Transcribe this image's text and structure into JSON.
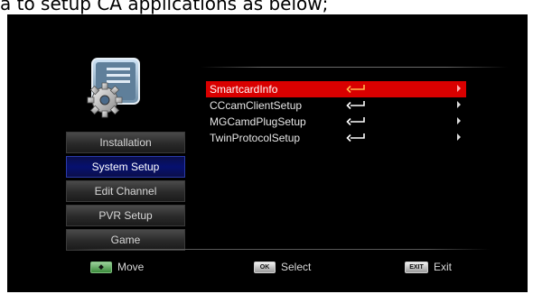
{
  "caption": "a to setup CA applications as below;",
  "sidebar": {
    "items": [
      {
        "label": "Installation",
        "active": false
      },
      {
        "label": "System Setup",
        "active": true
      },
      {
        "label": "Edit Channel",
        "active": false
      },
      {
        "label": "PVR Setup",
        "active": false
      },
      {
        "label": "Game",
        "active": false
      }
    ]
  },
  "list": {
    "items": [
      {
        "label": "SmartcardInfo",
        "selected": true
      },
      {
        "label": "CCcamClientSetup",
        "selected": false
      },
      {
        "label": "MGCamdPlugSetup",
        "selected": false
      },
      {
        "label": "TwinProtocolSetup",
        "selected": false
      }
    ]
  },
  "footer": {
    "move": {
      "key": "◆",
      "label": "Move"
    },
    "select": {
      "key": "OK",
      "label": "Select"
    },
    "exit": {
      "key": "EXIT",
      "label": "Exit"
    }
  },
  "colors": {
    "highlight": "#d90000",
    "active_menu": "#061070",
    "screen_bg": "#000000",
    "enter_arrow_selected": "#ffb84d"
  },
  "icons": {
    "app": "settings-gear-window-icon",
    "row_arrow": "enter-arrow-icon",
    "row_chevron": "chevron-right-icon"
  }
}
